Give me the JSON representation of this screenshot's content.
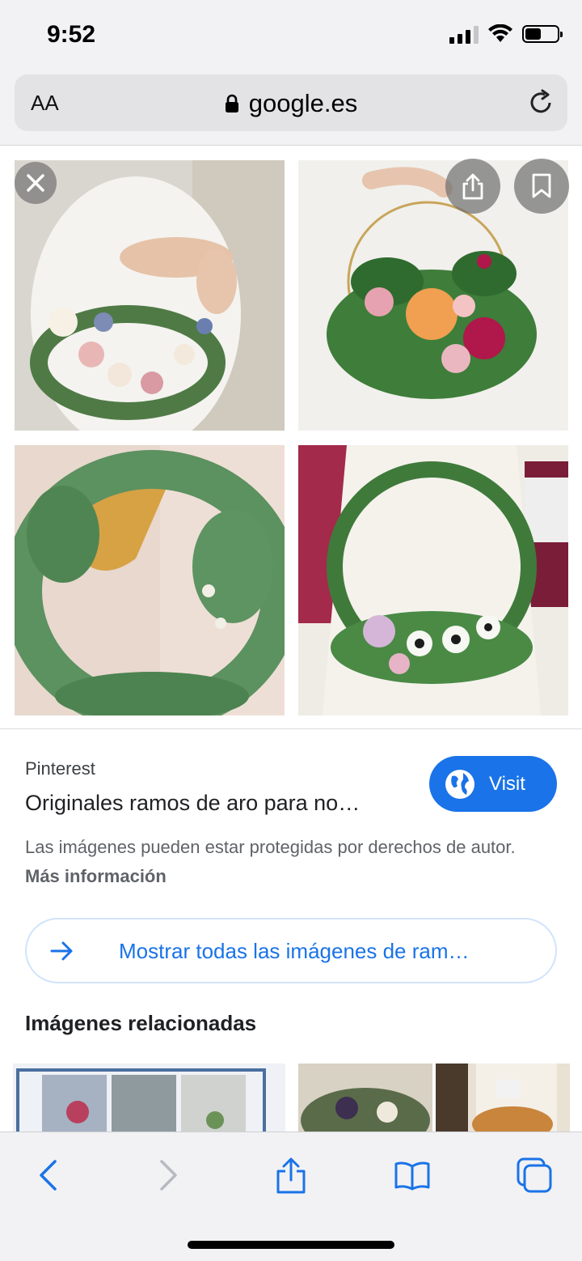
{
  "status_bar": {
    "time": "9:52"
  },
  "browser": {
    "text_size_label": "AA",
    "url": "google.es"
  },
  "result": {
    "source": "Pinterest",
    "title": "Originales ramos de aro para no…",
    "visit_label": "Visit",
    "copyright_text": "Las imágenes pueden estar protegidas por derechos de autor.",
    "more_info_label": "Más información",
    "show_all_label": "Mostrar todas las imágenes de ram…",
    "related_heading": "Imágenes relacionadas"
  },
  "icons": {
    "close": "close-icon",
    "share": "share-icon",
    "bookmark": "bookmark-icon",
    "globe": "globe-icon",
    "arrow": "arrow-right-icon",
    "back": "chevron-left-icon",
    "forward": "chevron-right-icon",
    "book": "book-icon",
    "tabs": "tabs-icon"
  },
  "colors": {
    "accent": "#1a73e8",
    "browser_chrome": "#f2f2f4"
  }
}
